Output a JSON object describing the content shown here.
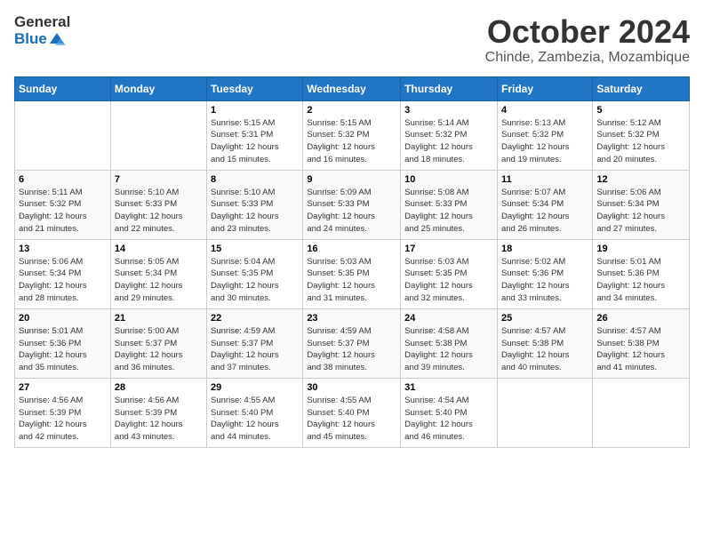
{
  "header": {
    "logo_general": "General",
    "logo_blue": "Blue",
    "month": "October 2024",
    "location": "Chinde, Zambezia, Mozambique"
  },
  "days_of_week": [
    "Sunday",
    "Monday",
    "Tuesday",
    "Wednesday",
    "Thursday",
    "Friday",
    "Saturday"
  ],
  "weeks": [
    [
      {
        "num": "",
        "detail": ""
      },
      {
        "num": "",
        "detail": ""
      },
      {
        "num": "1",
        "detail": "Sunrise: 5:15 AM\nSunset: 5:31 PM\nDaylight: 12 hours\nand 15 minutes."
      },
      {
        "num": "2",
        "detail": "Sunrise: 5:15 AM\nSunset: 5:32 PM\nDaylight: 12 hours\nand 16 minutes."
      },
      {
        "num": "3",
        "detail": "Sunrise: 5:14 AM\nSunset: 5:32 PM\nDaylight: 12 hours\nand 18 minutes."
      },
      {
        "num": "4",
        "detail": "Sunrise: 5:13 AM\nSunset: 5:32 PM\nDaylight: 12 hours\nand 19 minutes."
      },
      {
        "num": "5",
        "detail": "Sunrise: 5:12 AM\nSunset: 5:32 PM\nDaylight: 12 hours\nand 20 minutes."
      }
    ],
    [
      {
        "num": "6",
        "detail": "Sunrise: 5:11 AM\nSunset: 5:32 PM\nDaylight: 12 hours\nand 21 minutes."
      },
      {
        "num": "7",
        "detail": "Sunrise: 5:10 AM\nSunset: 5:33 PM\nDaylight: 12 hours\nand 22 minutes."
      },
      {
        "num": "8",
        "detail": "Sunrise: 5:10 AM\nSunset: 5:33 PM\nDaylight: 12 hours\nand 23 minutes."
      },
      {
        "num": "9",
        "detail": "Sunrise: 5:09 AM\nSunset: 5:33 PM\nDaylight: 12 hours\nand 24 minutes."
      },
      {
        "num": "10",
        "detail": "Sunrise: 5:08 AM\nSunset: 5:33 PM\nDaylight: 12 hours\nand 25 minutes."
      },
      {
        "num": "11",
        "detail": "Sunrise: 5:07 AM\nSunset: 5:34 PM\nDaylight: 12 hours\nand 26 minutes."
      },
      {
        "num": "12",
        "detail": "Sunrise: 5:06 AM\nSunset: 5:34 PM\nDaylight: 12 hours\nand 27 minutes."
      }
    ],
    [
      {
        "num": "13",
        "detail": "Sunrise: 5:06 AM\nSunset: 5:34 PM\nDaylight: 12 hours\nand 28 minutes."
      },
      {
        "num": "14",
        "detail": "Sunrise: 5:05 AM\nSunset: 5:34 PM\nDaylight: 12 hours\nand 29 minutes."
      },
      {
        "num": "15",
        "detail": "Sunrise: 5:04 AM\nSunset: 5:35 PM\nDaylight: 12 hours\nand 30 minutes."
      },
      {
        "num": "16",
        "detail": "Sunrise: 5:03 AM\nSunset: 5:35 PM\nDaylight: 12 hours\nand 31 minutes."
      },
      {
        "num": "17",
        "detail": "Sunrise: 5:03 AM\nSunset: 5:35 PM\nDaylight: 12 hours\nand 32 minutes."
      },
      {
        "num": "18",
        "detail": "Sunrise: 5:02 AM\nSunset: 5:36 PM\nDaylight: 12 hours\nand 33 minutes."
      },
      {
        "num": "19",
        "detail": "Sunrise: 5:01 AM\nSunset: 5:36 PM\nDaylight: 12 hours\nand 34 minutes."
      }
    ],
    [
      {
        "num": "20",
        "detail": "Sunrise: 5:01 AM\nSunset: 5:36 PM\nDaylight: 12 hours\nand 35 minutes."
      },
      {
        "num": "21",
        "detail": "Sunrise: 5:00 AM\nSunset: 5:37 PM\nDaylight: 12 hours\nand 36 minutes."
      },
      {
        "num": "22",
        "detail": "Sunrise: 4:59 AM\nSunset: 5:37 PM\nDaylight: 12 hours\nand 37 minutes."
      },
      {
        "num": "23",
        "detail": "Sunrise: 4:59 AM\nSunset: 5:37 PM\nDaylight: 12 hours\nand 38 minutes."
      },
      {
        "num": "24",
        "detail": "Sunrise: 4:58 AM\nSunset: 5:38 PM\nDaylight: 12 hours\nand 39 minutes."
      },
      {
        "num": "25",
        "detail": "Sunrise: 4:57 AM\nSunset: 5:38 PM\nDaylight: 12 hours\nand 40 minutes."
      },
      {
        "num": "26",
        "detail": "Sunrise: 4:57 AM\nSunset: 5:38 PM\nDaylight: 12 hours\nand 41 minutes."
      }
    ],
    [
      {
        "num": "27",
        "detail": "Sunrise: 4:56 AM\nSunset: 5:39 PM\nDaylight: 12 hours\nand 42 minutes."
      },
      {
        "num": "28",
        "detail": "Sunrise: 4:56 AM\nSunset: 5:39 PM\nDaylight: 12 hours\nand 43 minutes."
      },
      {
        "num": "29",
        "detail": "Sunrise: 4:55 AM\nSunset: 5:40 PM\nDaylight: 12 hours\nand 44 minutes."
      },
      {
        "num": "30",
        "detail": "Sunrise: 4:55 AM\nSunset: 5:40 PM\nDaylight: 12 hours\nand 45 minutes."
      },
      {
        "num": "31",
        "detail": "Sunrise: 4:54 AM\nSunset: 5:40 PM\nDaylight: 12 hours\nand 46 minutes."
      },
      {
        "num": "",
        "detail": ""
      },
      {
        "num": "",
        "detail": ""
      }
    ]
  ]
}
